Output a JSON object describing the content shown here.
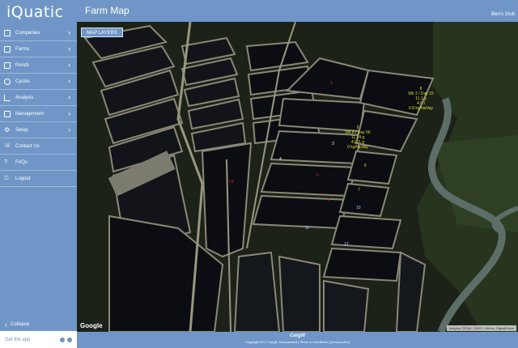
{
  "app": {
    "brand": "iQuatic",
    "page_title": "Farm Map",
    "user": "Ben's Stub"
  },
  "sidebar": {
    "items": [
      {
        "label": "Companies",
        "icon": "building-icon",
        "chevron": true
      },
      {
        "label": "Farms",
        "icon": "farm-icon",
        "chevron": true
      },
      {
        "label": "Ponds",
        "icon": "pond-icon",
        "chevron": true
      },
      {
        "label": "Cycles",
        "icon": "cycle-icon",
        "chevron": true
      },
      {
        "label": "Analysis",
        "icon": "chart-icon",
        "chevron": true
      },
      {
        "label": "Management",
        "icon": "briefcase-icon",
        "chevron": true
      },
      {
        "label": "Setup",
        "icon": "gear-icon",
        "chevron": true
      },
      {
        "label": "Contact Us",
        "icon": "phone-icon",
        "chevron": false
      },
      {
        "label": "FAQs",
        "icon": "question-icon",
        "chevron": false
      },
      {
        "label": "Logout",
        "icon": "logout-icon",
        "chevron": false
      }
    ],
    "collapse": "Collapse",
    "get_app": "Get the app"
  },
  "map": {
    "layers_button": "MAP LAYERS",
    "google": "Google",
    "attribution": "Imagery ©2018 , CNES / Airbus, DigitalGlobe",
    "pond_info": [
      {
        "line1": "8",
        "line2": "Wk 3 / Day 15",
        "line3": "11.1 g",
        "line4": "4.0 t",
        "line5": "0.8 kg/ha/day"
      },
      {
        "line1": "9",
        "line2": "Wk 8 / Day 56",
        "line3": "11.14 g",
        "line4": "41.11 g",
        "line5": "0 kg/ha/day"
      }
    ],
    "pond_numbers": [
      {
        "text": "1",
        "color": "#e02020"
      },
      {
        "text": "2",
        "color": "#e02020"
      },
      {
        "text": "3",
        "color": "#ffffff"
      },
      {
        "text": "4",
        "color": "#ffffff"
      },
      {
        "text": "5",
        "color": "#e02020"
      },
      {
        "text": "6",
        "color": "#dcdc2a"
      },
      {
        "text": "7",
        "color": "#dcdc2a"
      },
      {
        "text": "10",
        "color": "#aaccff"
      },
      {
        "text": "11",
        "color": "#aaccff"
      },
      {
        "text": "12",
        "color": "#aaccff"
      },
      {
        "text": "13",
        "color": "#e02020"
      }
    ]
  },
  "footer": {
    "logo": "Cargill",
    "copyright": "Copyright 2017 Cargill, Incorporated | Terms & Conditions | privacy policy"
  },
  "colors": {
    "brand": "#6f96c6",
    "water": "#0b0d12",
    "levee": "#8b8876"
  }
}
